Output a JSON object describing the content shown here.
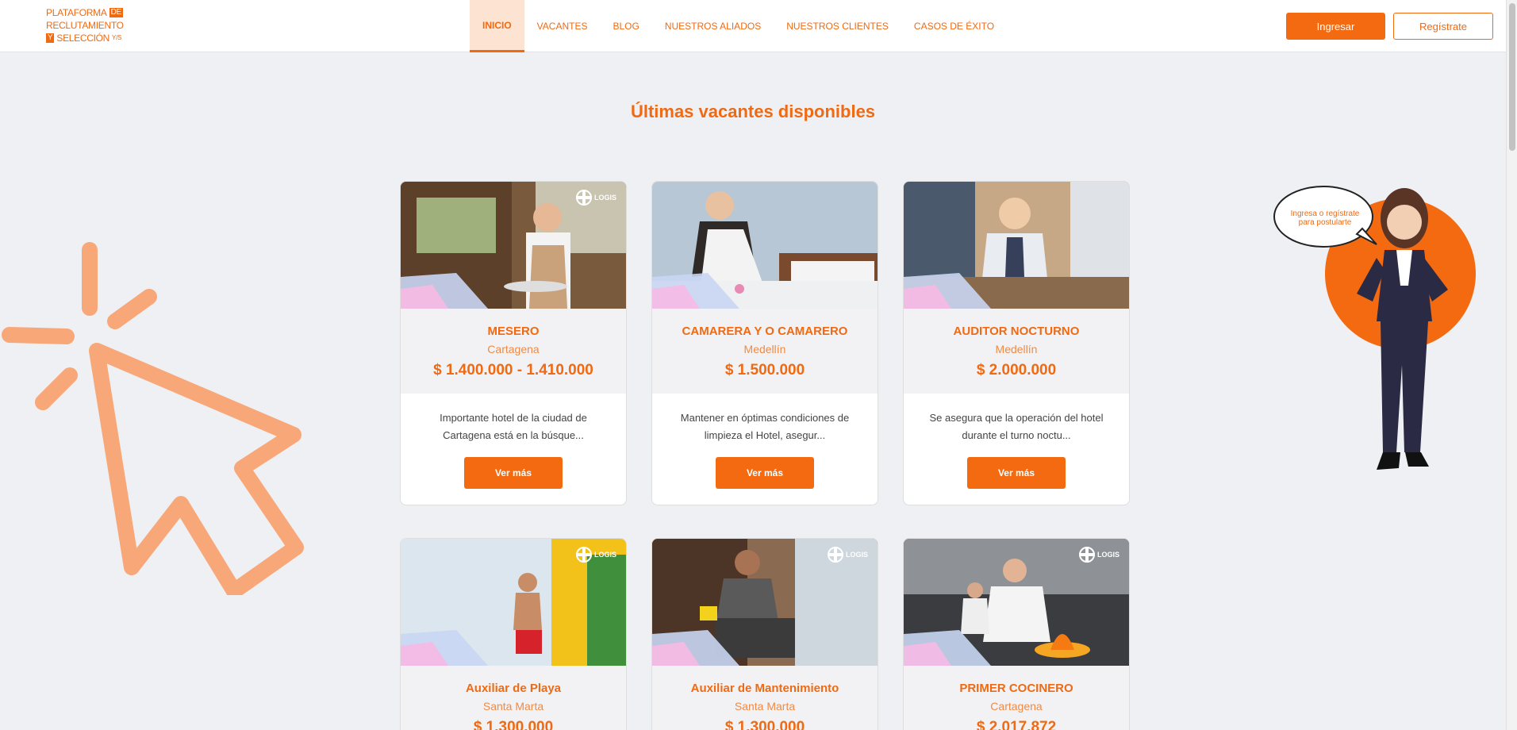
{
  "logo": {
    "line1": "PLATAFORMA",
    "line1_box": "DE",
    "line2": "RECLUTAMIENTO",
    "line3_box": "Y",
    "line3": "SELECCIÓN",
    "line3_tiny": "Y/S"
  },
  "nav": {
    "items": [
      {
        "label": "INICIO"
      },
      {
        "label": "VACANTES"
      },
      {
        "label": "BLOG"
      },
      {
        "label": "NUESTROS ALIADOS"
      },
      {
        "label": "NUESTROS CLIENTES"
      },
      {
        "label": "CASOS DE ÉXITO"
      }
    ],
    "active_index": 0
  },
  "auth": {
    "login_label": "Ingresar",
    "register_label": "Regístrate"
  },
  "main": {
    "title": "Últimas vacantes disponibles"
  },
  "mascot": {
    "bubble_text": "Ingresa o regístrate para postularte"
  },
  "cards": [
    {
      "title": "MESERO",
      "city": "Cartagena",
      "salary": "$ 1.400.000  - 1.410.000",
      "desc": "Importante hotel de la ciudad de Cartagena está en la búsque...",
      "button": "Ver más",
      "badge": "LOGIS"
    },
    {
      "title": "CAMARERA Y O CAMARERO",
      "city": "Medellín",
      "salary": "$ 1.500.000",
      "desc": "Mantener en óptimas condiciones de limpieza el Hotel, asegur...",
      "button": "Ver más",
      "badge": ""
    },
    {
      "title": "AUDITOR NOCTURNO",
      "city": "Medellín",
      "salary": "$ 2.000.000",
      "desc": "Se asegura que la operación del hotel durante el turno noctu...",
      "button": "Ver más",
      "badge": ""
    },
    {
      "title": "Auxiliar de Playa",
      "city": "Santa Marta",
      "salary": "$ 1.300.000",
      "desc": "",
      "button": "",
      "badge": "LOGIS"
    },
    {
      "title": "Auxiliar de Mantenimiento",
      "city": "Santa Marta",
      "salary": "$ 1.300.000",
      "desc": "",
      "button": "",
      "badge": "LOGIS"
    },
    {
      "title": "PRIMER COCINERO",
      "city": "Cartagena",
      "salary": "$ 2.017.872",
      "desc": "",
      "button": "",
      "badge": "LOGIS"
    }
  ],
  "colors": {
    "accent": "#f36a10",
    "accent_light": "#fde3d2",
    "background": "#eff0f4",
    "cursor_deco": "#f8a878"
  },
  "icons": {
    "cursor": "click-cursor-icon",
    "badge": "logis-logo-icon"
  }
}
